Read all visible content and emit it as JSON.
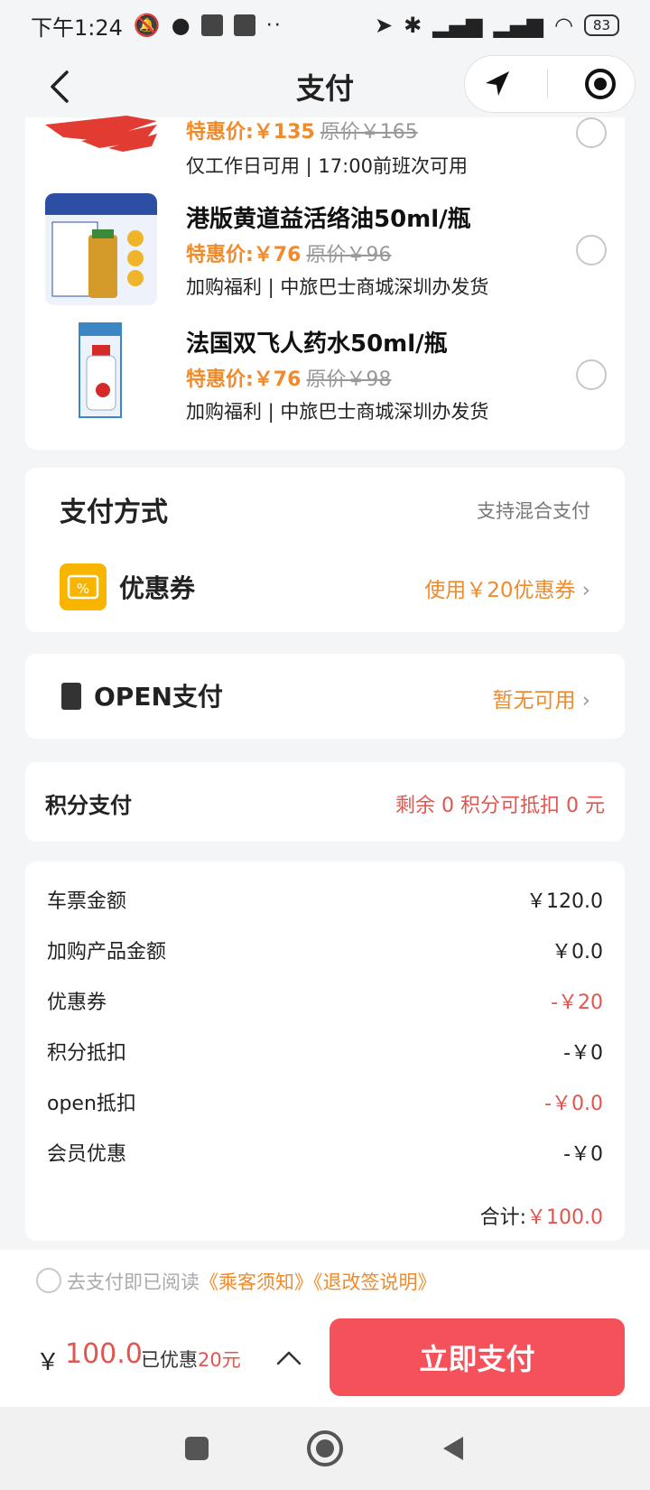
{
  "status_bar": {
    "time": "下午1:24",
    "battery": "83"
  },
  "nav": {
    "title": "支付"
  },
  "products": [
    {
      "name": "",
      "special_label": "特惠价:￥135",
      "original_label": "原价￥165",
      "note": "仅工作日可用 | 17:00前班次可用"
    },
    {
      "name": "港版黄道益活络油50ml/瓶",
      "special_label": "特惠价:￥76",
      "original_label": "原价￥96",
      "note": "加购福利 | 中旅巴士商城深圳办发货"
    },
    {
      "name": "法国双飞人药水50ml/瓶",
      "special_label": "特惠价:￥76",
      "original_label": "原价￥98",
      "note": "加购福利 | 中旅巴士商城深圳办发货"
    }
  ],
  "payment": {
    "title": "支付方式",
    "hint": "支持混合支付",
    "coupon_label": "优惠券",
    "coupon_value": "使用￥20优惠券",
    "coupon_icon_text": "%"
  },
  "open_pay": {
    "label": "OPEN支付",
    "value": "暂无可用"
  },
  "points": {
    "label": "积分支付",
    "value": "剩余 0 积分可抵扣 0 元"
  },
  "summary": {
    "rows": [
      {
        "label": "车票金额",
        "value": "￥120.0"
      },
      {
        "label": "加购产品金额",
        "value": "￥0.0"
      },
      {
        "label": "优惠券",
        "value": "-￥20"
      },
      {
        "label": "积分抵扣",
        "value": "-￥0"
      },
      {
        "label": "open抵扣",
        "value": "-￥0.0"
      },
      {
        "label": "会员优惠",
        "value": "-￥0"
      }
    ],
    "total_label": "合计:",
    "total_value": "￥100.0"
  },
  "agreement": {
    "prefix": "去支付即已阅读",
    "link1": "《乘客须知》",
    "link2": "《退改签说明》"
  },
  "pay_bar": {
    "currency": "￥",
    "amount": "100.0",
    "saved_prefix": "已优惠",
    "saved_amount": "20元",
    "button": "立即支付"
  },
  "colors": {
    "accent": "#f08a2a",
    "red": "#e2554f",
    "button": "#f4515a",
    "coupon_icon": "#f7b500"
  }
}
